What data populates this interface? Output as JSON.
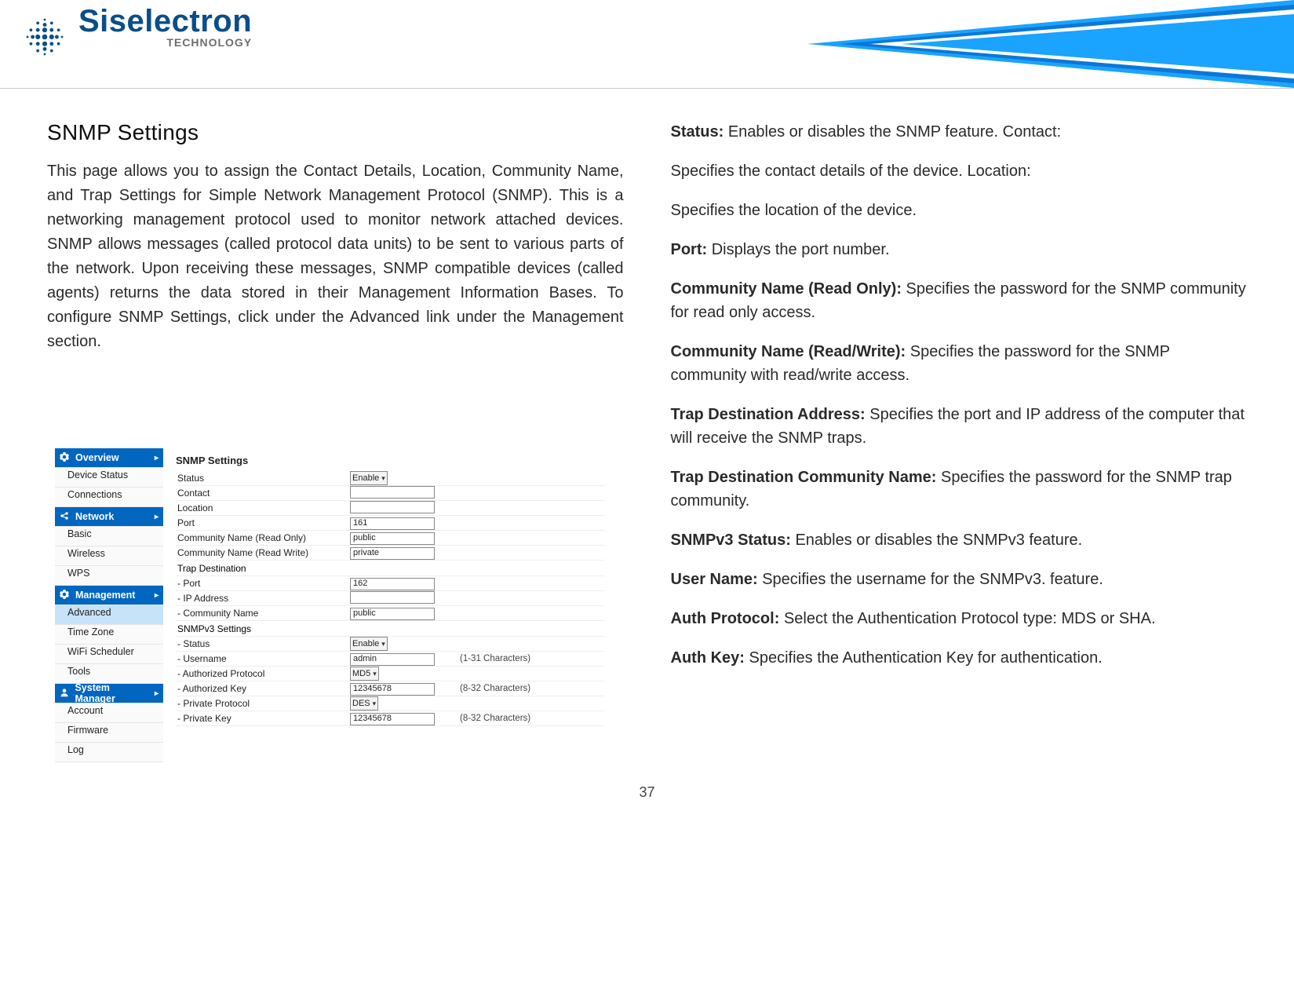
{
  "brand": {
    "name": "Siselectron",
    "sub": "TECHNOLOGY"
  },
  "left": {
    "title": "SNMP Settings",
    "body": "This page allows you to assign the Contact Details, Location, Community Name, and Trap Settings for Simple Network Management Protocol (SNMP). This is a networking management protocol used to monitor network attached devices. SNMP allows messages (called protocol data units) to be sent to various parts of the network. Upon receiving these messages, SNMP compatible devices (called agents) returns the data stored in their Management Information Bases. To configure SNMP Settings, click under the Advanced link under the Management section."
  },
  "sidebar": {
    "sections": [
      {
        "type": "header",
        "icon": "gear-icon",
        "label": "Overview"
      },
      {
        "type": "sub",
        "label": "Device Status"
      },
      {
        "type": "sub",
        "label": "Connections"
      },
      {
        "type": "header",
        "icon": "share-icon",
        "label": "Network"
      },
      {
        "type": "sub",
        "label": "Basic"
      },
      {
        "type": "sub",
        "label": "Wireless"
      },
      {
        "type": "sub",
        "label": "WPS"
      },
      {
        "type": "header",
        "icon": "gear-icon",
        "label": "Management"
      },
      {
        "type": "sub",
        "active": true,
        "label": "Advanced"
      },
      {
        "type": "sub",
        "label": "Time Zone"
      },
      {
        "type": "sub",
        "label": "WiFi Scheduler"
      },
      {
        "type": "sub",
        "label": "Tools"
      },
      {
        "type": "header",
        "icon": "person-icon",
        "label": "System Manager"
      },
      {
        "type": "sub",
        "label": "Account"
      },
      {
        "type": "sub",
        "label": "Firmware"
      },
      {
        "type": "sub",
        "label": "Log"
      }
    ]
  },
  "snmp_panel": {
    "title": "SNMP Settings",
    "rows": [
      {
        "kind": "select",
        "label": "Status",
        "value": "Enable",
        "hint": ""
      },
      {
        "kind": "input",
        "label": "Contact",
        "value": "",
        "hint": ""
      },
      {
        "kind": "input",
        "label": "Location",
        "value": "",
        "hint": ""
      },
      {
        "kind": "input",
        "label": "Port",
        "value": "161",
        "hint": ""
      },
      {
        "kind": "input",
        "label": "Community Name (Read Only)",
        "value": "public",
        "hint": ""
      },
      {
        "kind": "input",
        "label": "Community Name (Read Write)",
        "value": "private",
        "hint": ""
      },
      {
        "kind": "group",
        "label": "Trap Destination"
      },
      {
        "kind": "input",
        "label": "   - Port",
        "value": "162",
        "hint": ""
      },
      {
        "kind": "input",
        "label": "   - IP Address",
        "value": "",
        "hint": ""
      },
      {
        "kind": "input",
        "label": "   - Community Name",
        "value": "public",
        "hint": ""
      },
      {
        "kind": "group",
        "label": "SNMPv3 Settings"
      },
      {
        "kind": "select",
        "label": "   - Status",
        "value": "Enable",
        "hint": ""
      },
      {
        "kind": "input",
        "label": "   - Username",
        "value": "admin",
        "hint": "(1-31 Characters)"
      },
      {
        "kind": "select",
        "label": "   - Authorized Protocol",
        "value": "MD5",
        "hint": ""
      },
      {
        "kind": "input",
        "label": "   - Authorized Key",
        "value": "12345678",
        "hint": "(8-32 Characters)"
      },
      {
        "kind": "select",
        "label": "   - Private Protocol",
        "value": "DES",
        "hint": ""
      },
      {
        "kind": "input",
        "label": "   - Private Key",
        "value": "12345678",
        "hint": "(8-32 Characters)"
      }
    ]
  },
  "defs": [
    {
      "label": "Status:",
      "body": "Enables or disables the SNMP feature. Contact:"
    },
    {
      "label": "",
      "body": "Specifies the contact details of the device. Location:"
    },
    {
      "label": "",
      "body": "Specifies the location of the device."
    },
    {
      "label": "Port:",
      "body": "Displays the port number."
    },
    {
      "label": "Community Name (Read Only):",
      "body": "Specifies the password for the SNMP community for read only access."
    },
    {
      "label": "Community Name (Read/Write):",
      "body": "Specifies the password for the SNMP community with read/write access."
    },
    {
      "label": "Trap Destination Address:",
      "body": "Specifies the port and IP address of the computer that will receive the SNMP traps."
    },
    {
      "label": "Trap Destination Community Name:",
      "body": "Specifies the password for the SNMP trap community."
    },
    {
      "label": "SNMPv3 Status:",
      "body": "Enables or disables the SNMPv3 feature."
    },
    {
      "label": "User Name:",
      "body": "Specifies the username for the SNMPv3. feature."
    },
    {
      "label": "Auth Protocol:",
      "body": "Select the Authentication Protocol type: MDS or SHA."
    },
    {
      "label": "Auth Key:",
      "body": "Specifies the Authentication Key for authentication."
    }
  ],
  "page_number": "37"
}
